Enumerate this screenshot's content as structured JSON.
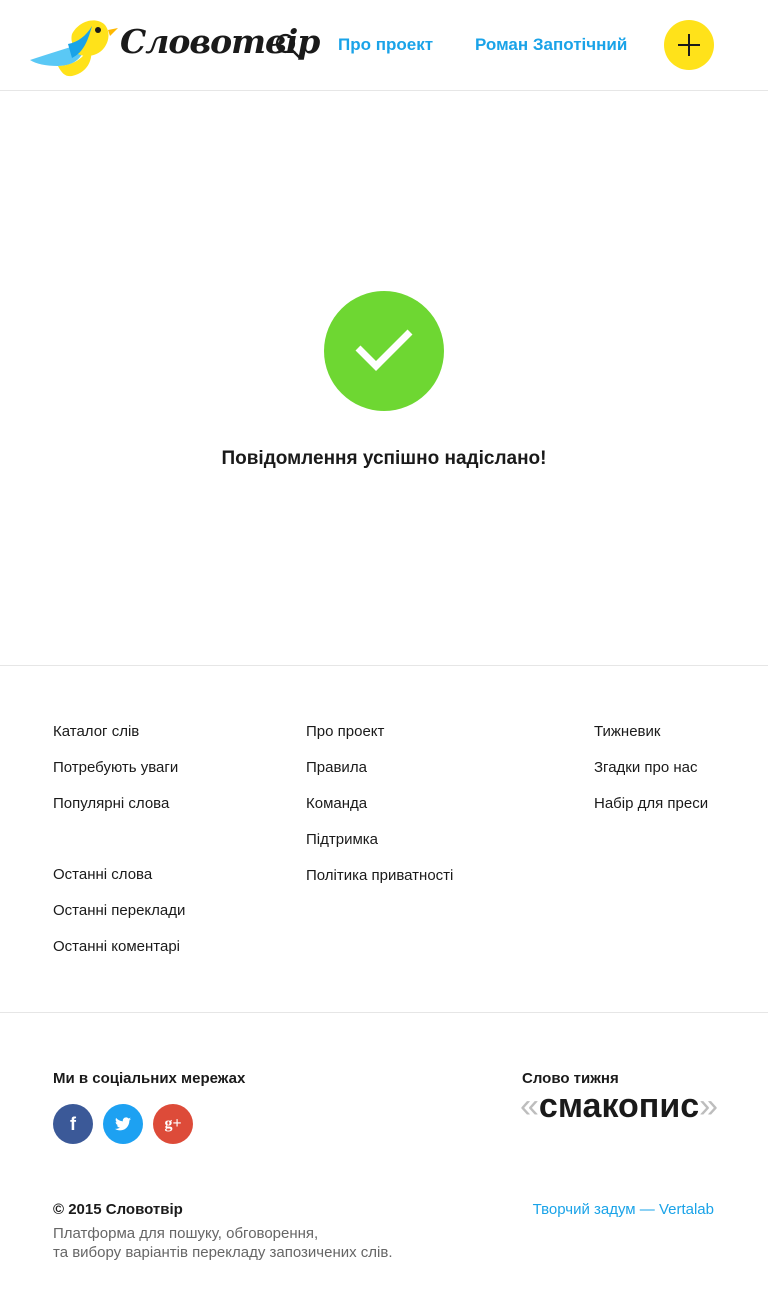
{
  "header": {
    "logo_text": "Словотвір",
    "search_icon": "search-icon",
    "nav": {
      "about": "Про проект",
      "user": "Роман Запотічний"
    },
    "add_icon": "plus-icon"
  },
  "success": {
    "icon": "check-icon",
    "message": "Повідомлення успішно надіслано!"
  },
  "footer": {
    "col1": [
      "Каталог слів",
      "Потребують уваги",
      "Популярні слова"
    ],
    "col1b": [
      "Останні слова",
      "Останні переклади",
      "Останні коментарі"
    ],
    "col2": [
      "Про проект",
      "Правила",
      "Команда",
      "Підтримка",
      "Політика приватності"
    ],
    "col3": [
      "Тижневик",
      "Згадки про нас",
      "Набір для преси"
    ],
    "social_title": "Ми в соціальних мережах",
    "social": [
      {
        "name": "facebook",
        "glyph": "f"
      },
      {
        "name": "twitter",
        "glyph": ""
      },
      {
        "name": "google-plus",
        "glyph": "g+"
      }
    ],
    "word_of_week_title": "Слово тижня",
    "word_of_week": "смакопис",
    "quote_open": "«",
    "quote_close": "»",
    "copyright": "© 2015 Словотвір",
    "description_line1": "Платформа для пошуку, обговорення,",
    "description_line2": "та вибору варіантів перекладу запозичених слів.",
    "credit": "Творчий задум — Vertalab"
  },
  "colors": {
    "accent_blue": "#1aa3e8",
    "accent_yellow": "#ffe21a",
    "success_green": "#6ed732",
    "facebook": "#3b5998",
    "twitter": "#1da1f2",
    "google_plus": "#dd4b39"
  }
}
